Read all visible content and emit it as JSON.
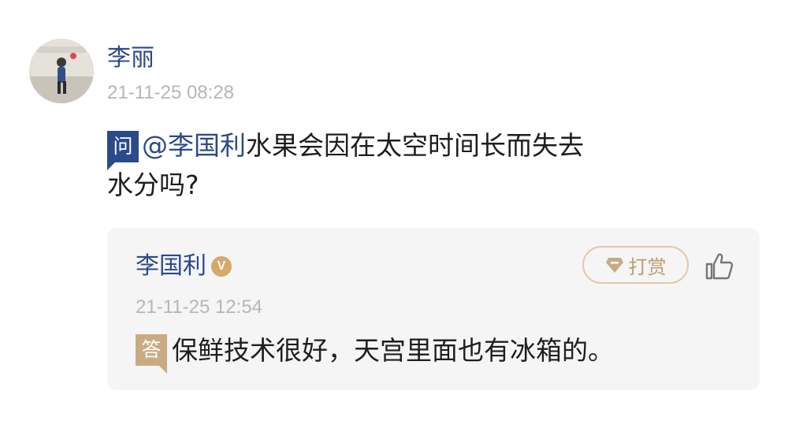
{
  "question_post": {
    "author_name": "李丽",
    "timestamp": "21-11-25 08:28",
    "badge": "问",
    "mention": "@李国利",
    "text_line1": "水果会因在太空时间长而失去",
    "text_line2": "水分吗?"
  },
  "reply": {
    "author_name": "李国利",
    "verified_badge": "V",
    "reward_label": "打赏",
    "timestamp": "21-11-25 12:54",
    "badge": "答",
    "text": "保鲜技术很好，天宫里面也有冰箱的。"
  },
  "icons": {
    "reward_icon": "diamond-icon",
    "like_icon": "thumbs-up-icon"
  },
  "colors": {
    "link_blue": "#2b4a8a",
    "gold": "#c9ab83",
    "muted_text": "#b6b6b6",
    "reply_bg": "#f5f5f5"
  }
}
